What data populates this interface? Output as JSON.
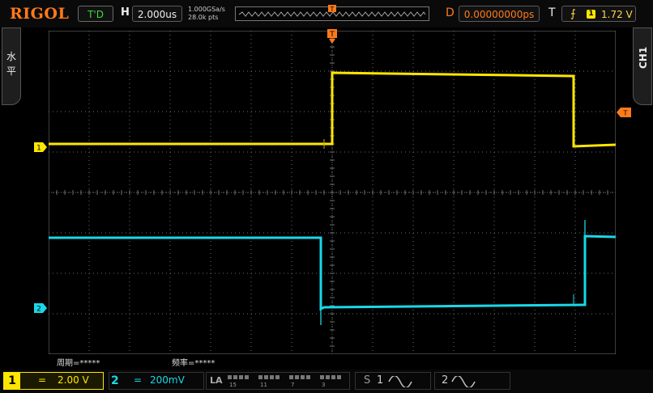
{
  "brand": "RIGOL",
  "top": {
    "run_state": "T'D",
    "h_label": "H",
    "timebase": "2.000us",
    "sample_rate": "1.000GSa/s",
    "memory_depth": "28.0k pts",
    "d_label": "D",
    "delay": "0.00000000ps",
    "t_label": "T",
    "trigger_source": "1",
    "trigger_level": "1.72 V",
    "trigger_edge_icon": "rising-edge-icon"
  },
  "side": {
    "left_tab": [
      "水",
      "平"
    ],
    "right_tab": "CH1",
    "trigger_marker": "T",
    "ch1_marker": "1",
    "ch2_marker": "2"
  },
  "measurements": {
    "period": "周期=*****",
    "frequency": "频率=*****"
  },
  "bottom": {
    "ch1": {
      "num": "1",
      "coupling": "=",
      "scale": "2.00 V"
    },
    "ch2": {
      "num": "2",
      "coupling": "=",
      "scale": "200mV"
    },
    "la": {
      "label": "LA",
      "groups": [
        "15",
        "11",
        "7",
        "3"
      ]
    },
    "s1": {
      "label": "S",
      "num": "1"
    },
    "s2": {
      "num": "2"
    }
  },
  "colors": {
    "ch1": "#ffe600",
    "ch2": "#19d8e8",
    "accent": "#ff7a1a",
    "grid": "#6b6b6b"
  }
}
